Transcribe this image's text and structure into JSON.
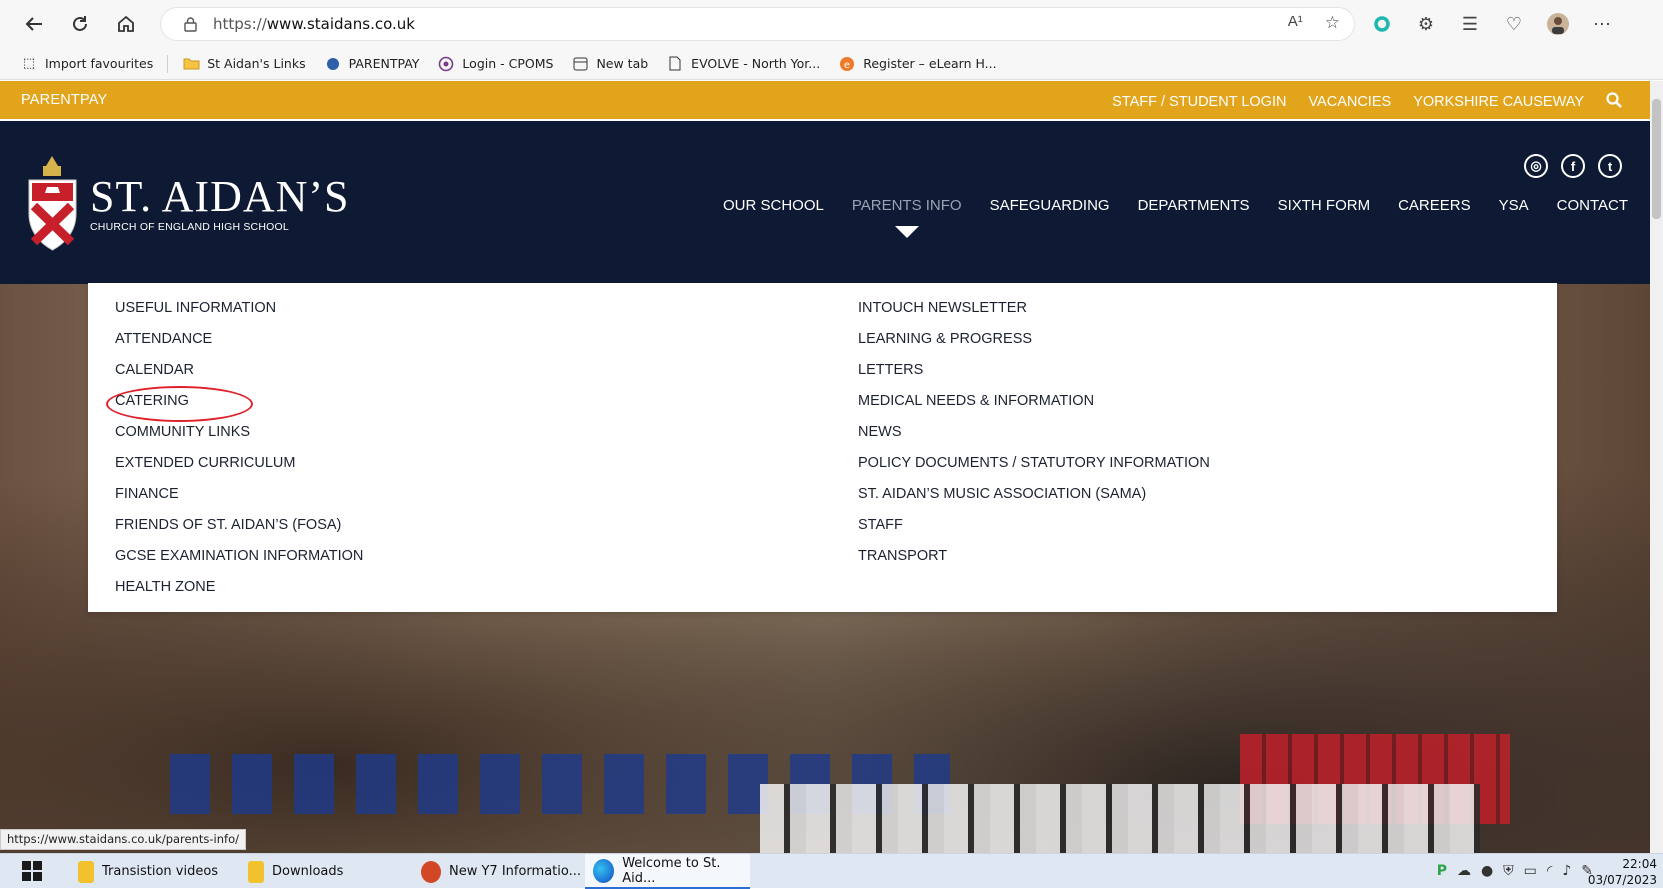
{
  "browser": {
    "url_prefix": "https://",
    "url_host": "www.staidans.co.uk",
    "nav_icons": [
      "back-icon",
      "refresh-icon",
      "home-icon"
    ],
    "read_aloud_label": "A¹",
    "favourites": [
      {
        "icon": "import-icon",
        "label": "Import favourites"
      },
      {
        "icon": "folder-icon",
        "label": "St Aidan's Links"
      },
      {
        "icon": "parentpay-icon",
        "label": "PARENTPAY"
      },
      {
        "icon": "cpoms-icon",
        "label": "Login - CPOMS"
      },
      {
        "icon": "tab-icon",
        "label": "New tab"
      },
      {
        "icon": "page-icon",
        "label": "EVOLVE - North Yor..."
      },
      {
        "icon": "elearn-icon",
        "label": "Register – eLearn H..."
      }
    ],
    "status_url": "https://www.staidans.co.uk/parents-info/"
  },
  "site": {
    "utility_left": "PARENTPAY",
    "utility_links": [
      "STAFF / STUDENT LOGIN",
      "VACANCIES",
      "YORKSHIRE CAUSEWAY"
    ],
    "logo_name": "ST. AIDAN’S",
    "logo_sub": "CHURCH OF ENGLAND HIGH SCHOOL",
    "social": [
      "◎",
      "f",
      "t"
    ],
    "nav": [
      "OUR SCHOOL",
      "PARENTS INFO",
      "SAFEGUARDING",
      "DEPARTMENTS",
      "SIXTH FORM",
      "CAREERS",
      "YSA",
      "CONTACT"
    ],
    "active_nav": "PARENTS INFO",
    "dropdown_left": [
      "USEFUL INFORMATION",
      "ATTENDANCE",
      "CALENDAR",
      "CATERING",
      "COMMUNITY LINKS",
      "EXTENDED CURRICULUM",
      "FINANCE",
      "FRIENDS OF ST. AIDAN’S (FOSA)",
      "GCSE EXAMINATION INFORMATION",
      "HEALTH ZONE"
    ],
    "dropdown_right": [
      "INTOUCH NEWSLETTER",
      "LEARNING & PROGRESS",
      "LETTERS",
      "MEDICAL NEEDS & INFORMATION",
      "NEWS",
      "POLICY DOCUMENTS / STATUTORY INFORMATION",
      "ST. AIDAN’S MUSIC ASSOCIATION (SAMA)",
      "STAFF",
      "TRANSPORT"
    ],
    "highlighted_item": "CATERING"
  },
  "taskbar": {
    "items": [
      {
        "label": "Transistion videos",
        "color": "#f2c12e"
      },
      {
        "label": "Downloads",
        "color": "#f2c12e"
      },
      {
        "label": "New Y7 Informatio...",
        "color": "#d24726"
      },
      {
        "label": "Welcome to St. Aid...",
        "color": "#1f8ad2",
        "active": true
      }
    ],
    "time": "22:04",
    "date": "03/07/2023"
  },
  "colors": {
    "utility_bar": "#e2a41a",
    "header": "#0e1a33",
    "highlight_circle": "#e0202a"
  }
}
